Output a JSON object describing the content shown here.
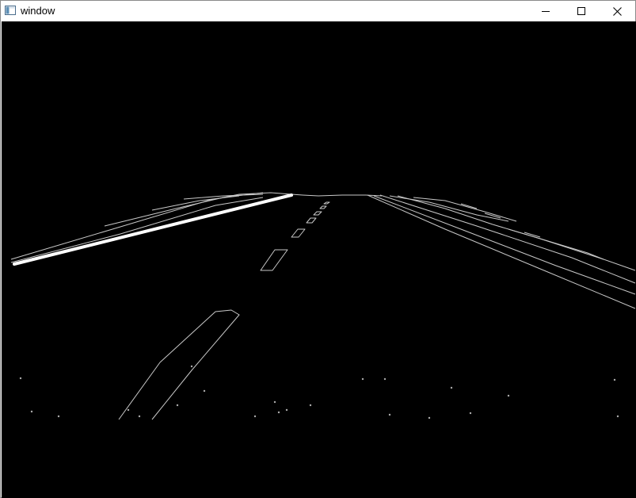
{
  "window": {
    "title": "window",
    "controls": {
      "minimize_icon": "minimize-icon",
      "maximize_icon": "maximize-icon",
      "close_icon": "close-icon"
    }
  },
  "canvas": {
    "background": "#000000",
    "edge_color": "#c8c8c8",
    "detected_line_color": "#ffffff"
  }
}
